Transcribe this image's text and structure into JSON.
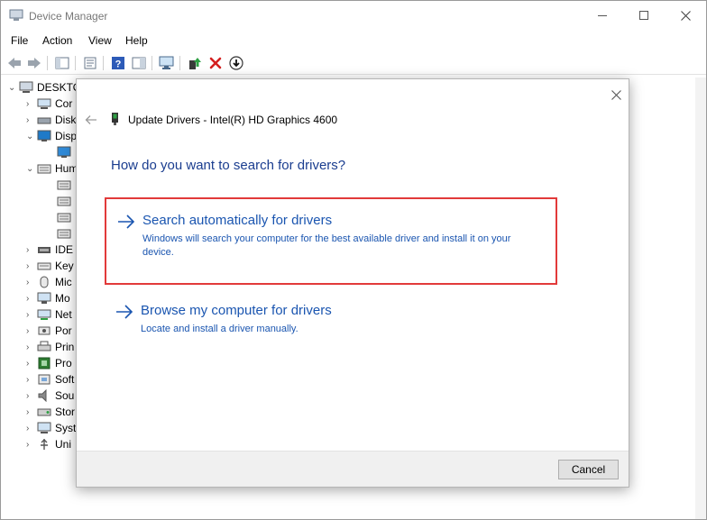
{
  "window": {
    "title": "Device Manager",
    "menu": [
      "File",
      "Action",
      "View",
      "Help"
    ]
  },
  "tree": {
    "root": "DESKTO",
    "items": [
      "Cor",
      "Disk",
      "Disp",
      "Hum",
      "IDE",
      "Key",
      "Mic",
      "Mo",
      "Net",
      "Por",
      "Prin",
      "Pro",
      "Soft",
      "Sou",
      "Stor",
      "Syst",
      "Uni"
    ]
  },
  "dialog": {
    "title": "Update Drivers - Intel(R) HD Graphics 4600",
    "question": "How do you want to search for drivers?",
    "options": [
      {
        "heading": "Search automatically for drivers",
        "description": "Windows will search your computer for the best available driver and install it on your device."
      },
      {
        "heading": "Browse my computer for drivers",
        "description": "Locate and install a driver manually."
      }
    ],
    "cancel_label": "Cancel"
  },
  "colors": {
    "link_blue": "#1a55b0",
    "heading_blue": "#1a3d8f",
    "highlight_red": "#e23a3a"
  }
}
